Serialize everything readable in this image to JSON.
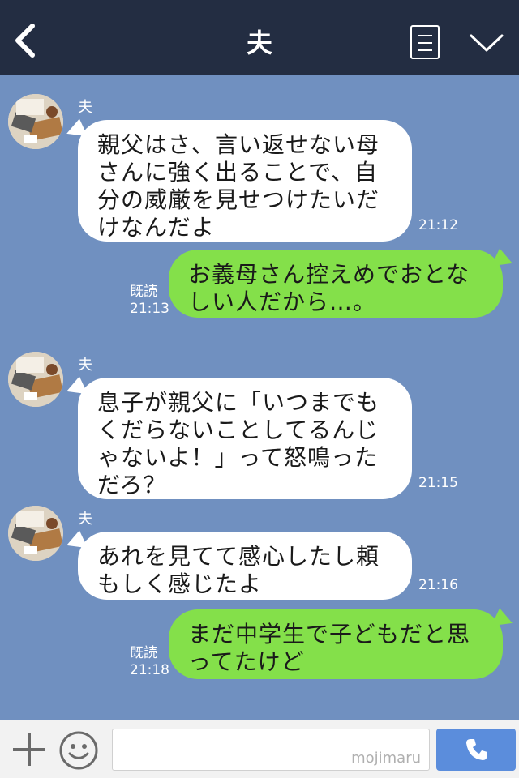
{
  "header": {
    "title": "夫",
    "back_icon": "chevron-left-icon",
    "menu_icon": "document-menu-icon",
    "expand_icon": "chevron-down-icon"
  },
  "messages": [
    {
      "direction": "in",
      "sender": "夫",
      "lines": [
        "親父はさ、言い返せない母",
        "さんに強く出ることで、自",
        "分の威厳を見せつけたいだ",
        "けなんだよ"
      ],
      "time": "21:12"
    },
    {
      "direction": "out",
      "lines": [
        "お義母さん控えめでおとな",
        "しい人だから…。"
      ],
      "read": "既読",
      "time": "21:13"
    },
    {
      "direction": "in",
      "sender": "夫",
      "lines": [
        "息子が親父に「いつまでも",
        "くだらないことしてるんじ",
        "ゃないよ！」って怒鳴った",
        "だろ？"
      ],
      "time": "21:15"
    },
    {
      "direction": "in",
      "sender": "夫",
      "lines": [
        "あれを見てて感心したし頼",
        "もしく感じたよ"
      ],
      "time": "21:16"
    },
    {
      "direction": "out",
      "lines": [
        "まだ中学生で子どもだと思",
        "ってたけど"
      ],
      "read": "既読",
      "time": "21:18"
    }
  ],
  "footer": {
    "plus_icon": "plus-icon",
    "sticker_icon": "smiley-icon",
    "input_value": "",
    "watermark": "mojimaru",
    "call_icon": "phone-icon"
  },
  "colors": {
    "header_bg": "#232d42",
    "chat_bg": "#7090c0",
    "incoming_bubble": "#ffffff",
    "outgoing_bubble": "#84e04a",
    "call_button": "#5b8ddc"
  }
}
